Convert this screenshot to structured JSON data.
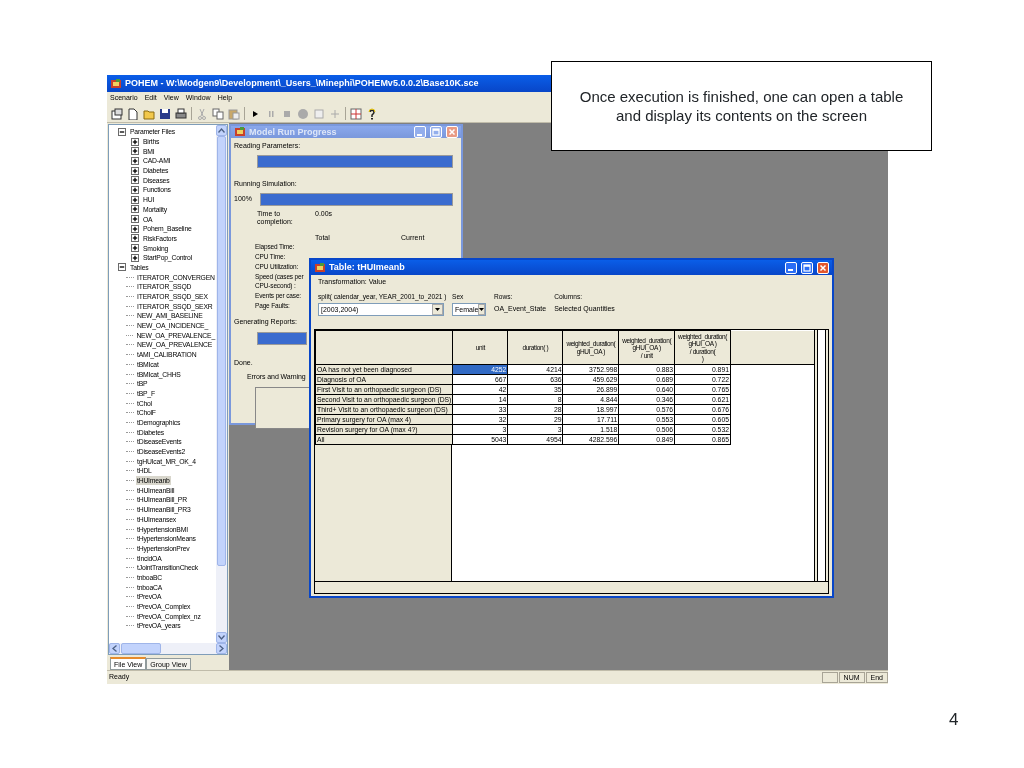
{
  "app": {
    "title": "POHEM - W:\\Modgen9\\Development\\_Users_\\Minephi\\POHEMv5.0.0.2\\Base10K.sce"
  },
  "menus": [
    "Scenario",
    "Edit",
    "View",
    "Window",
    "Help"
  ],
  "tree": [
    {
      "label": "Parameter Files",
      "expanded": true,
      "selected": false,
      "children": [
        {
          "label": "Births",
          "expanded": false,
          "selected": false
        },
        {
          "label": "BMI",
          "expanded": false,
          "selected": false
        },
        {
          "label": "CAD-AMI",
          "expanded": false,
          "selected": false
        },
        {
          "label": "Diabetes",
          "expanded": false,
          "selected": false
        },
        {
          "label": "Diseases",
          "expanded": false,
          "selected": false
        },
        {
          "label": "Functions",
          "expanded": false,
          "selected": false
        },
        {
          "label": "HUI",
          "expanded": false,
          "selected": false
        },
        {
          "label": "Mortality",
          "expanded": false,
          "selected": false
        },
        {
          "label": "OA",
          "expanded": false,
          "selected": false
        },
        {
          "label": "Pohem_Baseline",
          "expanded": false,
          "selected": false
        },
        {
          "label": "RiskFactors",
          "expanded": false,
          "selected": false
        },
        {
          "label": "Smoking",
          "expanded": false,
          "selected": false
        },
        {
          "label": "StartPop_Control",
          "expanded": false,
          "selected": false
        }
      ]
    },
    {
      "label": "Tables",
      "expanded": true,
      "selected": false,
      "children": [
        {
          "label": "ITERATOR_CONVERGEN",
          "selected": false
        },
        {
          "label": "ITERATOR_SSQD",
          "selected": false
        },
        {
          "label": "ITERATOR_SSQD_SEX",
          "selected": false
        },
        {
          "label": "ITERATOR_SSQD_SEXR",
          "selected": false
        },
        {
          "label": "NEW_AMI_BASELINE",
          "selected": false
        },
        {
          "label": "NEW_OA_INCIDENCE_",
          "selected": false
        },
        {
          "label": "NEW_OA_PREVALENCE_",
          "selected": false
        },
        {
          "label": "NEW_OA_PREVALENCE",
          "selected": false
        },
        {
          "label": "tAMI_CALIBRATION",
          "selected": false
        },
        {
          "label": "tBMIcat",
          "selected": false
        },
        {
          "label": "tBMIcat_CHHS",
          "selected": false
        },
        {
          "label": "tBP",
          "selected": false
        },
        {
          "label": "tBP_F",
          "selected": false
        },
        {
          "label": "tChol",
          "selected": false
        },
        {
          "label": "tCholF",
          "selected": false
        },
        {
          "label": "tDemographics",
          "selected": false
        },
        {
          "label": "tDiabetes",
          "selected": false
        },
        {
          "label": "tDiseaseEvents",
          "selected": false
        },
        {
          "label": "tDiseaseEvents2",
          "selected": false
        },
        {
          "label": "tgHUIcat_MR_OK_4",
          "selected": false
        },
        {
          "label": "tHDL",
          "selected": false
        },
        {
          "label": "tHUImeanb",
          "selected": true
        },
        {
          "label": "tHUImeanBill",
          "selected": false
        },
        {
          "label": "tHUImeanBill_PR",
          "selected": false
        },
        {
          "label": "tHUImeanBill_PR3",
          "selected": false
        },
        {
          "label": "tHUImeansex",
          "selected": false
        },
        {
          "label": "tHypertensionBMI",
          "selected": false
        },
        {
          "label": "tHypertensionMeans",
          "selected": false
        },
        {
          "label": "tHypertensionPrev",
          "selected": false
        },
        {
          "label": "tIncidOA",
          "selected": false
        },
        {
          "label": "tJointTransitionCheck",
          "selected": false
        },
        {
          "label": "tnboaBC",
          "selected": false
        },
        {
          "label": "tnboaCA",
          "selected": false
        },
        {
          "label": "tPrevOA",
          "selected": false
        },
        {
          "label": "tPrevOA_Complex",
          "selected": false
        },
        {
          "label": "tPrevOA_Complex_nz",
          "selected": false
        },
        {
          "label": "tPrevOA_years",
          "selected": false
        }
      ]
    }
  ],
  "view_tabs": [
    {
      "label": "File View",
      "selected": true
    },
    {
      "label": "Group View",
      "selected": false
    }
  ],
  "progress_window": {
    "title": "Model Run Progress",
    "active": false,
    "reading": {
      "label": "Reading Parameters:",
      "level": 1
    },
    "running": {
      "label": "Running Simulation:",
      "percent": "100%",
      "level": 1
    },
    "time_label": "Time to completion:",
    "time_value": "0.00s",
    "stat_columns": [
      "Total",
      "Current"
    ],
    "stats": [
      "Elapsed Time:",
      "CPU Time:",
      "CPU Utilization:",
      "Speed (cases per\nCPU-second) :",
      "Events per case:",
      "Page Faults:"
    ],
    "generating": {
      "label": "Generating Reports:",
      "level": 1
    },
    "done": "Done.",
    "errors_label": "Errors and Warning"
  },
  "table_window": {
    "title": "Table: tHUImeanb",
    "active": true,
    "transformation": "Transformation: Value",
    "split_label": "split( calendar_year, YEAR_2001_to_2021 )",
    "split_value": "[2003,2004)",
    "sex_label": "Sex",
    "sex_value": "Female",
    "rows_label": "Rows:",
    "rows_value": "OA_Event_State",
    "columns_label": "Columns:",
    "columns_value": "Selected Quantities",
    "columns": [
      "unit",
      "duration( )",
      "weighted_duration(\ngHUI_OA )",
      "weighted_duration(\ngHUI_OA )\n/ unit",
      "weighted_duration(\ngHUI_OA )\n/ duration(\n)"
    ],
    "rows": [
      {
        "label": "OA has not yet been diagnosed",
        "cells": [
          {
            "text": "4252",
            "selected": true
          },
          {
            "text": "4214",
            "selected": false
          },
          {
            "text": "3752.998",
            "selected": false
          },
          {
            "text": "0.883",
            "selected": false
          },
          {
            "text": "0.891",
            "selected": false
          }
        ]
      },
      {
        "label": "Diagnosis of OA",
        "cells": [
          {
            "text": "667",
            "selected": false
          },
          {
            "text": "636",
            "selected": false
          },
          {
            "text": "459.629",
            "selected": false
          },
          {
            "text": "0.689",
            "selected": false
          },
          {
            "text": "0.722",
            "selected": false
          }
        ]
      },
      {
        "label": "First Visit to an orthopaedic surgeon (DS)",
        "cells": [
          {
            "text": "42",
            "selected": false
          },
          {
            "text": "35",
            "selected": false
          },
          {
            "text": "26.899",
            "selected": false
          },
          {
            "text": "0.640",
            "selected": false
          },
          {
            "text": "0.765",
            "selected": false
          }
        ]
      },
      {
        "label": "Second Visit to an orthopaedic surgeon (DS)",
        "cells": [
          {
            "text": "14",
            "selected": false
          },
          {
            "text": "8",
            "selected": false
          },
          {
            "text": "4.844",
            "selected": false
          },
          {
            "text": "0.346",
            "selected": false
          },
          {
            "text": "0.621",
            "selected": false
          }
        ]
      },
      {
        "label": "Third+ Visit to an orthopaedic surgeon (DS)",
        "cells": [
          {
            "text": "33",
            "selected": false
          },
          {
            "text": "28",
            "selected": false
          },
          {
            "text": "18.997",
            "selected": false
          },
          {
            "text": "0.576",
            "selected": false
          },
          {
            "text": "0.676",
            "selected": false
          }
        ]
      },
      {
        "label": "Primary surgery for OA (max 4)",
        "cells": [
          {
            "text": "32",
            "selected": false
          },
          {
            "text": "29",
            "selected": false
          },
          {
            "text": "17.711",
            "selected": false
          },
          {
            "text": "0.553",
            "selected": false
          },
          {
            "text": "0.605",
            "selected": false
          }
        ]
      },
      {
        "label": "Revision surgery for OA (max 4?)",
        "cells": [
          {
            "text": "3",
            "selected": false
          },
          {
            "text": "3",
            "selected": false
          },
          {
            "text": "1.518",
            "selected": false
          },
          {
            "text": "0.506",
            "selected": false
          },
          {
            "text": "0.532",
            "selected": false
          }
        ]
      },
      {
        "label": "All",
        "cells": [
          {
            "text": "5043",
            "selected": false
          },
          {
            "text": "4954",
            "selected": false
          },
          {
            "text": "4282.596",
            "selected": false
          },
          {
            "text": "0.849",
            "selected": false
          },
          {
            "text": "0.865",
            "selected": false
          }
        ]
      }
    ]
  },
  "status_bar": {
    "text": "Ready",
    "indicators": [
      "NUM",
      "End"
    ]
  },
  "callout": "Once execution is finished, one can open a table and display its contents on the screen",
  "slide_number": "4"
}
